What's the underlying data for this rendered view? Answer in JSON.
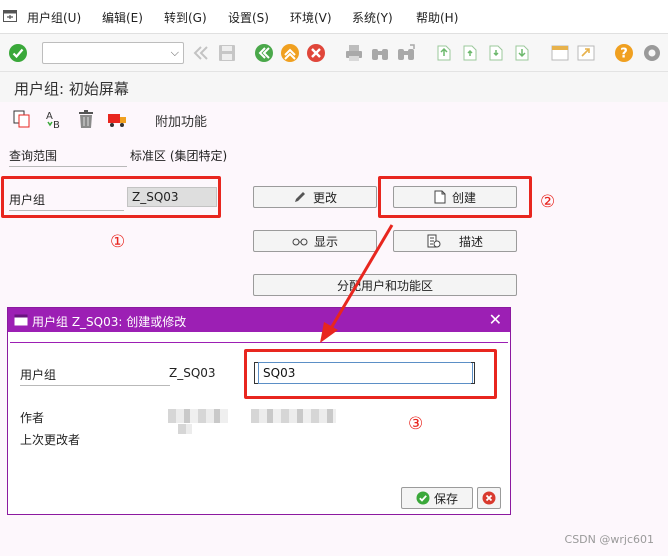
{
  "menu": {
    "items": [
      "用户组(U)",
      "编辑(E)",
      "转到(G)",
      "设置(S)",
      "环境(V)",
      "系统(Y)",
      "帮助(H)"
    ]
  },
  "toolbar": {
    "command_field": "",
    "icons": [
      "enter-icon",
      "back-nav-icon",
      "save-icon",
      "back-icon",
      "exit-icon",
      "cancel-icon",
      "print-icon",
      "find-icon",
      "find-next-icon",
      "first-page-icon",
      "prev-page-icon",
      "next-page-icon",
      "last-page-icon",
      "new-session-icon",
      "shortcut-icon",
      "help-icon",
      "settings-icon"
    ]
  },
  "page": {
    "title": "用户组: 初始屏幕"
  },
  "app_toolbar": {
    "extras": "附加功能"
  },
  "form": {
    "query_scope_label": "查询范围",
    "query_scope_value": "标准区 (集团特定)",
    "user_group_label": "用户组",
    "user_group_value": "Z_SQ03",
    "change_btn": "更改",
    "create_btn": "创建",
    "display_btn": "显示",
    "describe_btn": "描述",
    "assign_btn": "分配用户和功能区"
  },
  "annotations": {
    "one": "①",
    "two": "②",
    "three": "③"
  },
  "dialog": {
    "title": "用户组 Z_SQ03: 创建或修改",
    "close": "✕",
    "user_group_label": "用户组",
    "user_group_value": "Z_SQ03",
    "input_value": "SQ03",
    "author_label": "作者",
    "last_changed_label": "上次更改者",
    "save_btn": "保存"
  },
  "watermark": "CSDN @wrjc601",
  "colors": {
    "annotation_red": "#e8261f",
    "dialog_purple": "#9c1fb4",
    "green_icon": "#3aa83a",
    "orange_icon": "#f0a020"
  }
}
